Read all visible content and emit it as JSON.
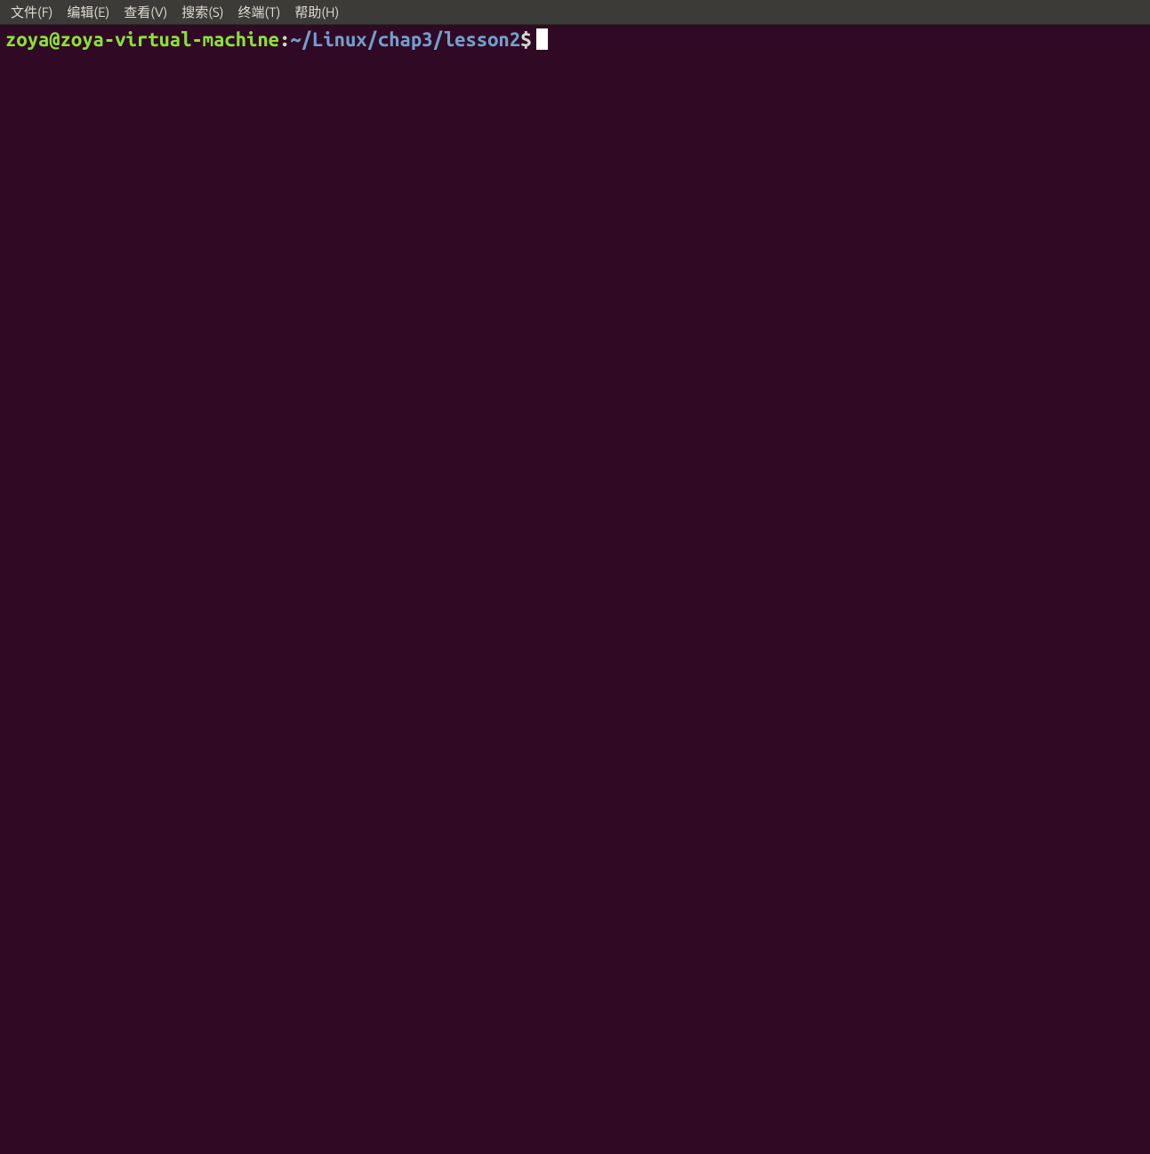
{
  "menubar": {
    "items": [
      {
        "label": "文件(F)"
      },
      {
        "label": "编辑(E)"
      },
      {
        "label": "查看(V)"
      },
      {
        "label": "搜索(S)"
      },
      {
        "label": "终端(T)"
      },
      {
        "label": "帮助(H)"
      }
    ]
  },
  "prompt": {
    "user_host": "zoya@zoya-virtual-machine",
    "colon": ":",
    "path": "~/Linux/chap3/lesson2",
    "dollar": "$"
  }
}
